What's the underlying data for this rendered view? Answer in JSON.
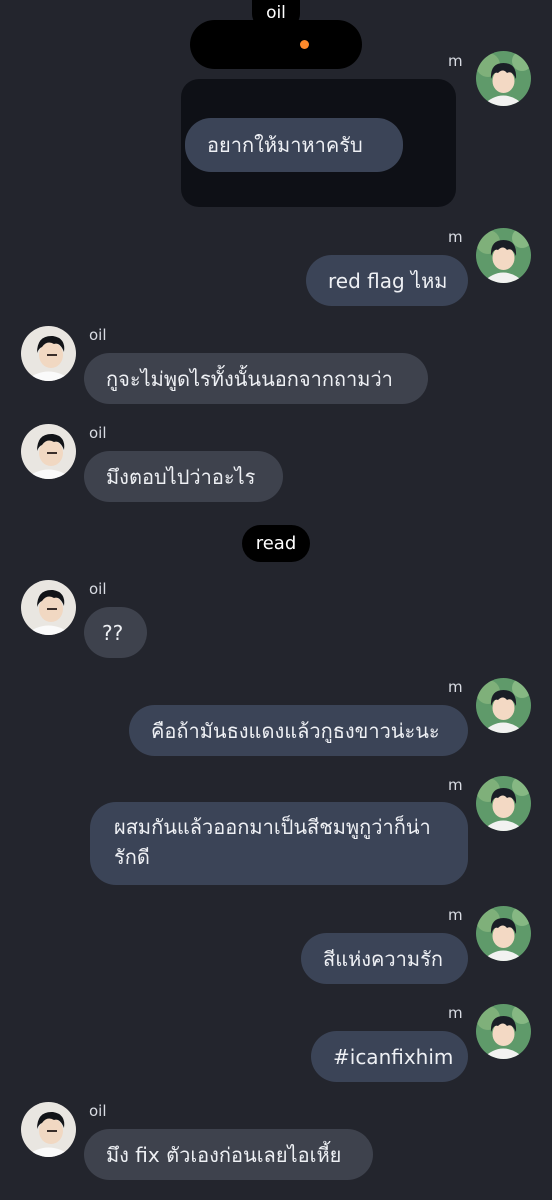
{
  "top_label": "oil",
  "read_marker": "read",
  "accent_color": "#ff8a2b",
  "messages": [
    {
      "sender": "m",
      "text": "อยากให้มาหาครับ"
    },
    {
      "sender": "m",
      "text": "red flag ไหม"
    },
    {
      "sender": "oil",
      "text": "กูจะไม่พูดไรทั้งนั้นนอกจากถามว่า"
    },
    {
      "sender": "oil",
      "text": "มึงตอบไปว่าอะไร"
    },
    {
      "sender": "oil",
      "text": "??"
    },
    {
      "sender": "m",
      "text": "คือถ้ามันธงแดงแล้วกูธงขาวน่ะนะ"
    },
    {
      "sender": "m",
      "text": "ผสมกันแล้วออกมาเป็นสีชมพูกูว่าก็น่ารักดี"
    },
    {
      "sender": "m",
      "text": "สีแห่งความรัก"
    },
    {
      "sender": "m",
      "text": "#icanfixhim"
    },
    {
      "sender": "oil",
      "text": "มึง fix ตัวเองก่อนเลยไอเหี้ย"
    }
  ],
  "avatars": {
    "m": "avatar-m-icon",
    "oil": "avatar-oil-icon"
  }
}
